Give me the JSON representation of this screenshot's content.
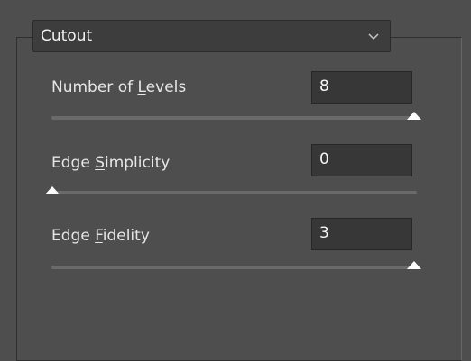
{
  "filter": {
    "selected": "Cutout",
    "options": [
      "Cutout"
    ]
  },
  "params": [
    {
      "label_pre": "Number of ",
      "label_ul": "L",
      "label_post": "evels",
      "value": "8",
      "slider_fraction": 1.0
    },
    {
      "label_pre": "Edge ",
      "label_ul": "S",
      "label_post": "implicity",
      "value": "0",
      "slider_fraction": 0.0
    },
    {
      "label_pre": "Edge ",
      "label_ul": "F",
      "label_post": "idelity",
      "value": "3",
      "slider_fraction": 1.0
    }
  ],
  "colors": {
    "panel": "#4e4e4e",
    "field": "#373737",
    "track": "#6a6a6a",
    "thumb": "#ffffff"
  },
  "icons": {
    "dropdown": "chevron-down-icon",
    "slider": "triangle-thumb-icon"
  }
}
